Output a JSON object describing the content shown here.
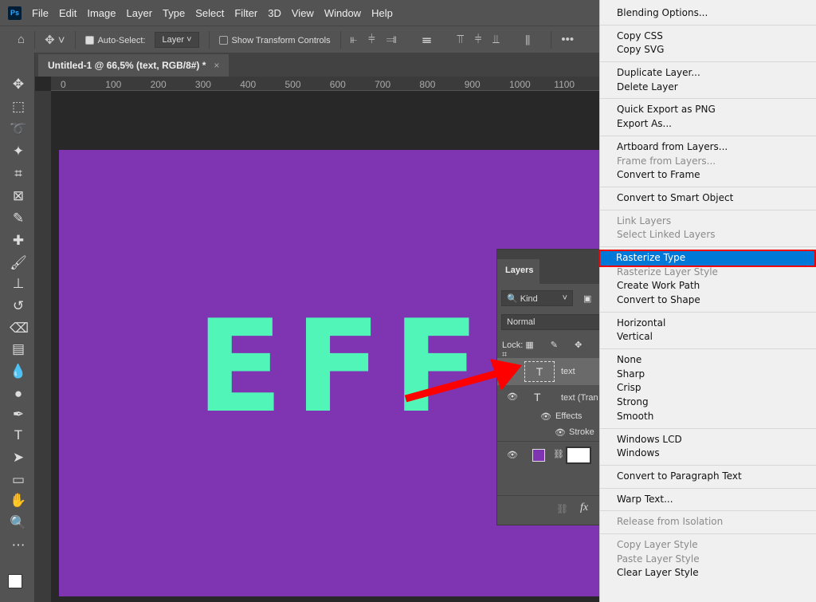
{
  "app": {
    "logo": "Ps",
    "menus": [
      "File",
      "Edit",
      "Image",
      "Layer",
      "Type",
      "Select",
      "Filter",
      "3D",
      "View",
      "Window",
      "Help"
    ]
  },
  "options": {
    "auto_select_label": "Auto-Select:",
    "auto_select_checked": true,
    "auto_select_value": "Layer",
    "show_transform_label": "Show Transform Controls",
    "show_transform_checked": false,
    "more": "•••"
  },
  "document": {
    "tab_title": "Untitled-1 @ 66,5% (text, RGB/8#) *",
    "close": "×",
    "ruler_ticks": [
      "0",
      "100",
      "200",
      "300",
      "400",
      "500",
      "600",
      "700",
      "800",
      "900",
      "1000",
      "1100"
    ],
    "canvas_text": "EFFEC",
    "canvas_color": "#7f35b2",
    "text_color": "#52f5b8"
  },
  "layers": {
    "tab": "Layers",
    "filter": "Kind",
    "blend_mode": "Normal",
    "lock_label": "Lock:",
    "rows": [
      {
        "name": "text",
        "selected": true
      },
      {
        "name": "text (Tran"
      },
      {
        "name": "Effects"
      },
      {
        "name": "Stroke"
      }
    ],
    "fill_color": "#7f35b2",
    "fx": "fx"
  },
  "context_menu": {
    "groups": [
      [
        {
          "label": "Blending Options..."
        }
      ],
      [
        {
          "label": "Copy CSS"
        },
        {
          "label": "Copy SVG"
        }
      ],
      [
        {
          "label": "Duplicate Layer..."
        },
        {
          "label": "Delete Layer"
        }
      ],
      [
        {
          "label": "Quick Export as PNG"
        },
        {
          "label": "Export As..."
        }
      ],
      [
        {
          "label": "Artboard from Layers..."
        },
        {
          "label": "Frame from Layers...",
          "disabled": true
        },
        {
          "label": "Convert to Frame"
        }
      ],
      [
        {
          "label": "Convert to Smart Object"
        }
      ],
      [
        {
          "label": "Link Layers",
          "disabled": true
        },
        {
          "label": "Select Linked Layers",
          "disabled": true
        }
      ],
      [
        {
          "label": "Rasterize Type",
          "highlighted": true
        },
        {
          "label": "Rasterize Layer Style",
          "disabled": true
        },
        {
          "label": "Create Work Path"
        },
        {
          "label": "Convert to Shape"
        }
      ],
      [
        {
          "label": "Horizontal"
        },
        {
          "label": "Vertical"
        }
      ],
      [
        {
          "label": "None"
        },
        {
          "label": "Sharp"
        },
        {
          "label": "Crisp"
        },
        {
          "label": "Strong"
        },
        {
          "label": "Smooth"
        }
      ],
      [
        {
          "label": "Windows LCD"
        },
        {
          "label": "Windows"
        }
      ],
      [
        {
          "label": "Convert to Paragraph Text"
        }
      ],
      [
        {
          "label": "Warp Text..."
        }
      ],
      [
        {
          "label": "Release from Isolation",
          "disabled": true
        }
      ],
      [
        {
          "label": "Copy Layer Style",
          "disabled": true
        },
        {
          "label": "Paste Layer Style",
          "disabled": true
        },
        {
          "label": "Clear Layer Style"
        }
      ]
    ]
  }
}
